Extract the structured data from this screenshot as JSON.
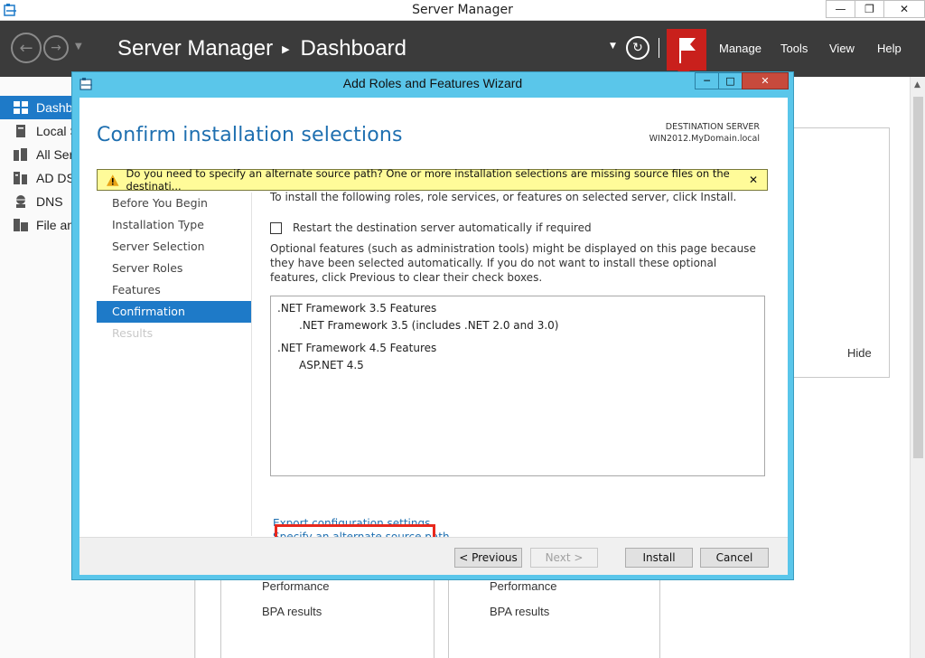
{
  "window": {
    "title": "Server Manager",
    "minimize": "—",
    "restore": "❐",
    "close": "✕"
  },
  "header": {
    "app_name": "Server Manager",
    "page": "Dashboard",
    "menus": [
      "Manage",
      "Tools",
      "View",
      "Help"
    ]
  },
  "sidebar": {
    "items": [
      {
        "label": "Dashb",
        "icon": "dashboard-icon"
      },
      {
        "label": "Local S",
        "icon": "server-icon"
      },
      {
        "label": "All Ser",
        "icon": "servers-icon"
      },
      {
        "label": "AD DS",
        "icon": "ad-icon"
      },
      {
        "label": "DNS",
        "icon": "dns-icon"
      },
      {
        "label": "File an",
        "icon": "file-services-icon"
      }
    ]
  },
  "background": {
    "hide_label": "Hide",
    "tile1": {
      "performance": "Performance",
      "bpa": "BPA results"
    },
    "tile2": {
      "performance": "Performance",
      "bpa": "BPA results"
    }
  },
  "dialog": {
    "title": "Add Roles and Features Wizard",
    "heading": "Confirm installation selections",
    "destination_label": "DESTINATION SERVER",
    "destination_value": "WIN2012.MyDomain.local",
    "warning": "Do you need to specify an alternate source path? One or more installation selections are missing source files on the destinati...",
    "steps": [
      {
        "label": "Before You Begin",
        "state": "normal"
      },
      {
        "label": "Installation Type",
        "state": "normal"
      },
      {
        "label": "Server Selection",
        "state": "normal"
      },
      {
        "label": "Server Roles",
        "state": "normal"
      },
      {
        "label": "Features",
        "state": "normal"
      },
      {
        "label": "Confirmation",
        "state": "active"
      },
      {
        "label": "Results",
        "state": "disabled"
      }
    ],
    "intro": "To install the following roles, role services, or features on selected server, click Install.",
    "restart_label": "Restart the destination server automatically if required",
    "restart_checked": false,
    "optional_text": "Optional features (such as administration tools) might be displayed on this page because they have been selected automatically. If you do not want to install these optional features, click Previous to clear their check boxes.",
    "selections": [
      {
        "label": ".NET Framework 3.5 Features",
        "level": 0
      },
      {
        "label": ".NET Framework 3.5 (includes .NET 2.0 and 3.0)",
        "level": 1
      },
      {
        "label": ".NET Framework 4.5 Features",
        "level": 0
      },
      {
        "label": "ASP.NET 4.5",
        "level": 1
      }
    ],
    "export_link": "Export configuration settings",
    "alt_source_link": "Specify an alternate source path",
    "buttons": {
      "previous": "< Previous",
      "next": "Next >",
      "install": "Install",
      "cancel": "Cancel"
    }
  },
  "colors": {
    "accent": "#1e7ac8",
    "dialog_frame": "#5ac6ea",
    "header_bg": "#3b3b3b",
    "notification_flag": "#c9201c",
    "highlight_box": "#e8281d",
    "warning_bg": "#fffb99"
  }
}
